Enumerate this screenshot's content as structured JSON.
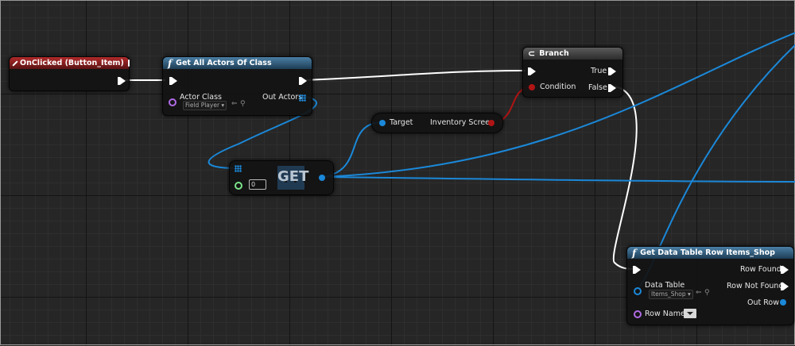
{
  "nodes": {
    "onclicked": {
      "title": "OnClicked (Button_Item)"
    },
    "get_all_actors": {
      "title": "Get All Actors Of Class",
      "actor_class_label": "Actor Class",
      "actor_class_value": "Field Player",
      "out_actors_label": "Out Actors"
    },
    "branch": {
      "title": "Branch",
      "true_label": "True",
      "condition_label": "Condition",
      "false_label": "False"
    },
    "target_node": {
      "target_label": "Target",
      "inventory_label": "Inventory Screen"
    },
    "get_node": {
      "label": "GET",
      "index_value": "0"
    },
    "get_data_table_row": {
      "title": "Get Data Table Row Items_Shop",
      "row_found_label": "Row Found",
      "row_not_found_label": "Row Not Found",
      "out_row_label": "Out Row",
      "data_table_label": "Data Table",
      "data_table_value": "Items_Shop",
      "row_name_label": "Row Name"
    }
  },
  "colors": {
    "event_header": "#b12a2a",
    "function_header": "#4a7fa5",
    "object_wire": "#1b88d8",
    "exec_wire": "#ffffff",
    "bool_wire": "#b01414"
  }
}
